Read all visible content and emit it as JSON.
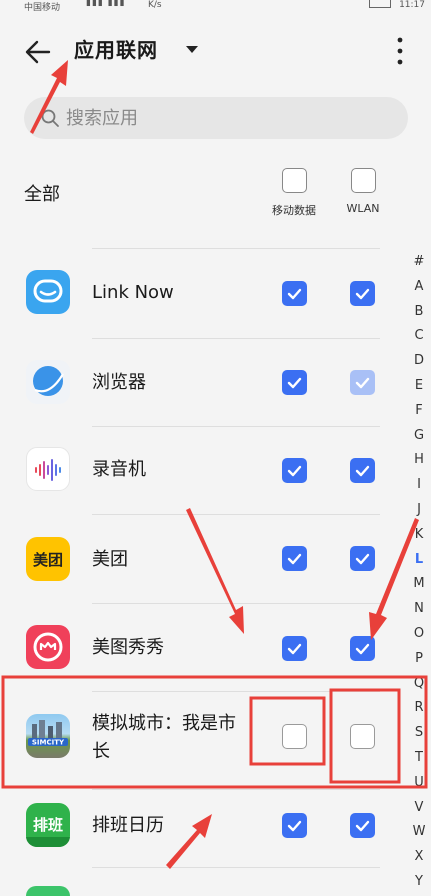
{
  "status_bar": {
    "carrier": "中国移动",
    "signal": "▮▮▮ ▮▮▮",
    "speed": "K/s",
    "time": "11:17"
  },
  "header": {
    "title": "应用联网",
    "back_icon": "arrow-left-icon",
    "menu_icon": "more-vertical-icon"
  },
  "search": {
    "placeholder": "搜索应用",
    "value": ""
  },
  "all_row": {
    "label": "全部",
    "mobile_label": "移动数据",
    "wlan_label": "WLAN",
    "mobile_checked": false,
    "wlan_checked": false
  },
  "apps": [
    {
      "name": "Link Now",
      "mobile": true,
      "wlan": true,
      "icon": "link-now-icon"
    },
    {
      "name": "浏览器",
      "mobile": true,
      "wlan": true,
      "wlan_disabled": true,
      "icon": "browser-icon"
    },
    {
      "name": "录音机",
      "mobile": true,
      "wlan": true,
      "icon": "recorder-icon"
    },
    {
      "name": "美团",
      "mobile": true,
      "wlan": true,
      "icon": "meituan-icon",
      "icon_text": "美团"
    },
    {
      "name": "美图秀秀",
      "mobile": true,
      "wlan": true,
      "icon": "meitu-icon"
    },
    {
      "name": "模拟城市：我是市长",
      "mobile": false,
      "wlan": false,
      "icon": "simcity-icon",
      "icon_text": "SIMCITY"
    },
    {
      "name": "排班日历",
      "mobile": true,
      "wlan": true,
      "icon": "shift-calendar-icon",
      "icon_text": "排班"
    }
  ],
  "index_letters": [
    "#",
    "A",
    "B",
    "C",
    "D",
    "E",
    "F",
    "G",
    "H",
    "I",
    "J",
    "K",
    "L",
    "M",
    "N",
    "O",
    "P",
    "Q",
    "R",
    "S",
    "T",
    "U",
    "V",
    "W",
    "X",
    "Y"
  ],
  "index_active": "L",
  "colors": {
    "accent": "#3b6ff2",
    "annotation": "#e8403a"
  }
}
